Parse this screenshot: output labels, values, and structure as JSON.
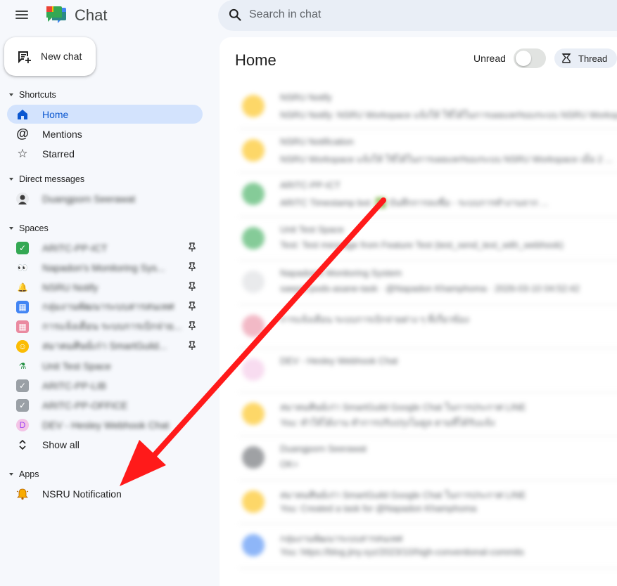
{
  "app": {
    "title": "Chat"
  },
  "search": {
    "placeholder": "Search in chat"
  },
  "new_chat": {
    "label": "New chat"
  },
  "sidebar": {
    "shortcuts_heading": "Shortcuts",
    "shortcuts": [
      {
        "label": "Home",
        "icon": "home-icon",
        "active": true
      },
      {
        "label": "Mentions",
        "icon": "at-icon"
      },
      {
        "label": "Starred",
        "icon": "star-icon"
      }
    ],
    "dm_heading": "Direct messages",
    "dms": [
      {
        "label": "Duangporn Seerawat",
        "icon": "avatar"
      }
    ],
    "spaces_heading": "Spaces",
    "spaces": [
      {
        "label": "ARITC-PP-ICT",
        "icon": "check-box-icon",
        "color": "#34a853",
        "pinned": true
      },
      {
        "label": "Napadon's Monitoring Sys...",
        "icon": "eyes-icon",
        "color": "#ffffff",
        "pinned": true
      },
      {
        "label": "NSRU Notify",
        "icon": "bell-icon",
        "color": "#fbbc04",
        "pinned": true
      },
      {
        "label": "กลุ่มงานพัฒนาระบบสารสนเทศ",
        "icon": "grid-icon",
        "color": "#4285f4",
        "pinned": true
      },
      {
        "label": "การแจ้งเตือน ระบบการเบิกจ่าย...",
        "icon": "grid-icon",
        "color": "#ea8aa0",
        "pinned": true
      },
      {
        "label": "สมาคมศิษย์เก่า SmartGuild...",
        "icon": "smile-icon",
        "color": "#fbbc04",
        "pinned": true
      },
      {
        "label": "Unit Test Space",
        "icon": "test-tube-icon",
        "color": "#34a853"
      },
      {
        "label": "ARITC-PP-LIB",
        "icon": "check-box-icon",
        "color": "#9aa0a6"
      },
      {
        "label": "ARITC-PP-OFFICE",
        "icon": "check-box-icon",
        "color": "#9aa0a6"
      },
      {
        "label": "DEV - Hesley Webhook Chat",
        "icon": "letter-d-icon",
        "color": "#f3c4e6"
      }
    ],
    "show_all": "Show all",
    "apps_heading": "Apps",
    "apps": [
      {
        "label": "NSRU Notification",
        "icon": "bell-icon"
      }
    ]
  },
  "main": {
    "title": "Home",
    "unread_label": "Unread",
    "unread_on": false,
    "thread_label": "Thread",
    "conversations": [
      {
        "name": "NSRU Notify",
        "preview": "NSRU Notify: NSRU Workspace แจ้งให้ ใช้ได้ในการเผยแพร่ของระบบ NSRU Workspace...",
        "color": "#fbbc04"
      },
      {
        "name": "NSRU Notification",
        "preview": "NSRU Workspace แจ้งให้ ใช้ได้ในการเผยแพร่ของระบบ NSRU Workspace เมื่อ 2 ...",
        "color": "#fbbc04"
      },
      {
        "name": "ARITC-PP-ICT",
        "preview": "ARITC Timestamp bot: ✅ บันทึกการลงชื่อ - ระบบการทำงานจาก ...",
        "color": "#34a853"
      },
      {
        "name": "Unit Test Space",
        "preview": "Test: Test message from Feature Test (test_send_text_with_webhook)",
        "color": "#34a853"
      },
      {
        "name": "Napadon's Monitoring System",
        "preview": "saepol-pods-asane-task · @Napadon Khamphoma · 2026-03-10 04:52:42",
        "color": "#dadce0"
      },
      {
        "name": "การแจ้งเตือน ระบบการเบิกจ่ายต่าง ๆ ที่เกี่ยวข้อง",
        "preview": "",
        "color": "#ea8aa0"
      },
      {
        "name": "DEV - Hesley Webhook Chat",
        "preview": "",
        "color": "#f3c4e6"
      },
      {
        "name": "สมาคมศิษย์เก่า SmartGuild Google Chat ในการประกาศ LINE",
        "preview": "You: ทำให้ได้งาน ทำการปรับปรุงโมดูล ตามที่ได้รับแจ้ง",
        "color": "#fbbc04"
      },
      {
        "name": "Duangporn Seerawat",
        "preview": "OK+",
        "color": "#5f6368"
      },
      {
        "name": "สมาคมศิษย์เก่า SmartGuild Google Chat ในการประกาศ LINE",
        "preview": "You: Created a task for @Napadon Khamphoma",
        "color": "#fbbc04"
      },
      {
        "name": "กลุ่มงานพัฒนาระบบสารสนเทศ",
        "preview": "You: https://blog.jiny.xyz/2023/10/high-conventional-commits",
        "color": "#4285f4"
      }
    ]
  },
  "colors": {
    "accent": "#0b57d0",
    "active_bg": "#d3e3fd",
    "arrow": "#ff1a1a"
  }
}
